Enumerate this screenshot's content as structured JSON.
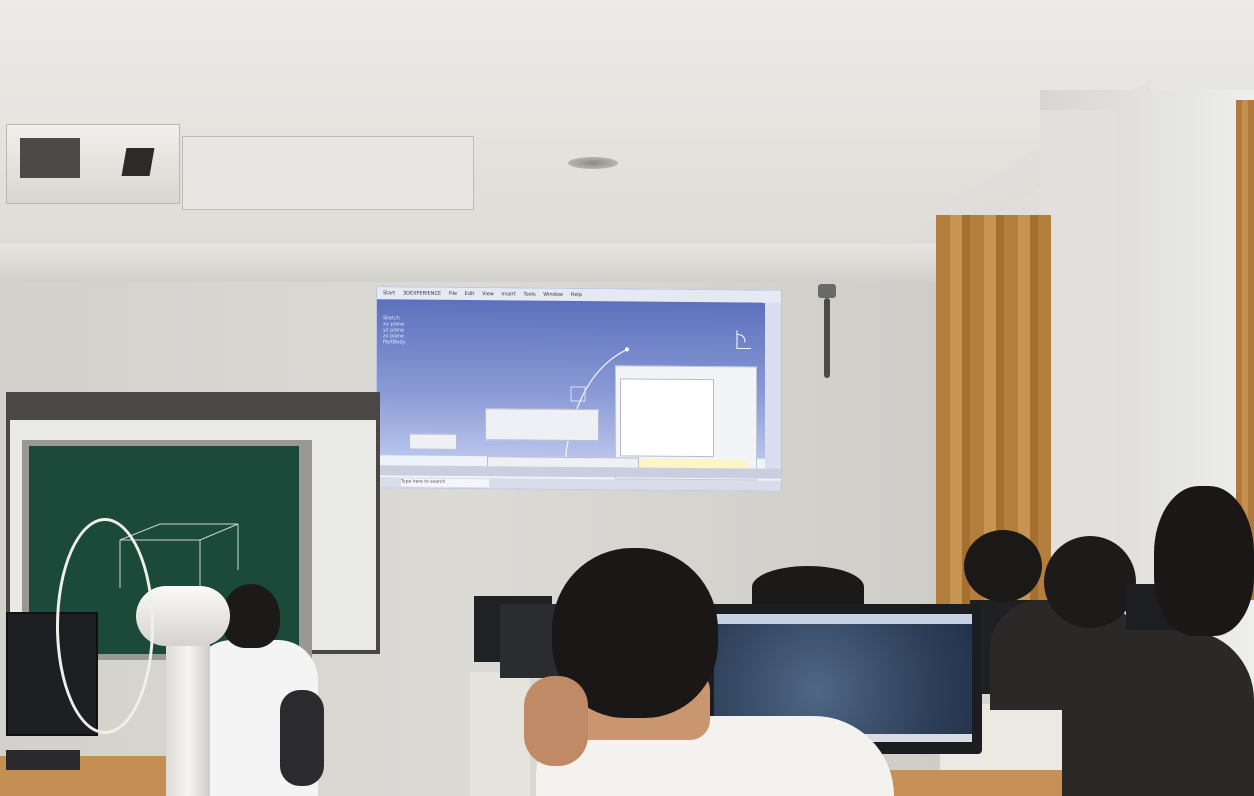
{
  "scene": {
    "description_colors": {
      "wall": "#d9d7d2",
      "curtain": "#b47e3d",
      "chalkboard": "#1b4a3b",
      "projection_bg": "#6c7fc6"
    }
  },
  "projection": {
    "menu_items": [
      "Start",
      "3DEXPERIENCE",
      "File",
      "Edit",
      "View",
      "Insert",
      "Tools",
      "Window",
      "Help"
    ],
    "tree_items": [
      "Sketch",
      "xy plane",
      "yz plane",
      "zx plane",
      "PartBody"
    ],
    "search_placeholder": "Type here to search"
  }
}
